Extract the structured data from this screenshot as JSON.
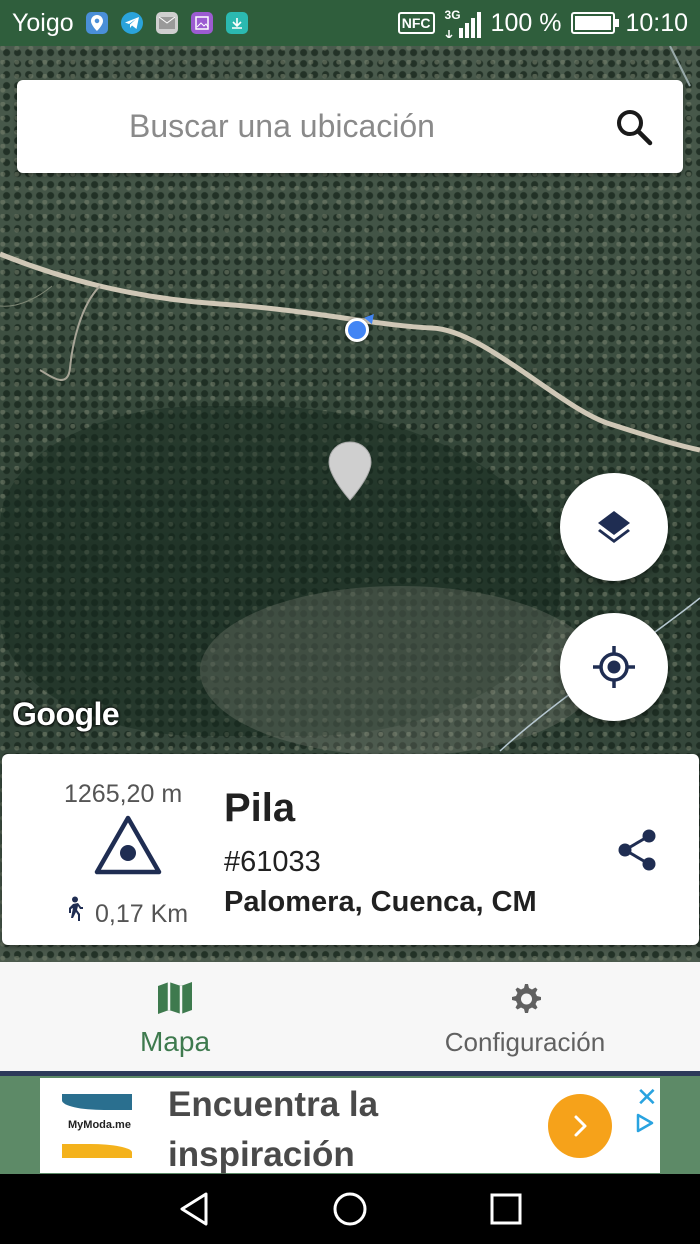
{
  "status_bar": {
    "carrier": "Yoigo",
    "nfc": "NFC",
    "network": "3G",
    "battery": "100 %",
    "battery_level": 1.0,
    "time": "10:10"
  },
  "search": {
    "placeholder": "Buscar una ubicación"
  },
  "map": {
    "attribution": "Google"
  },
  "info_card": {
    "elevation": "1265,20 m",
    "distance": "0,17 Km",
    "name": "Pila",
    "id": "#61033",
    "place": "Palomera, Cuenca, CM"
  },
  "bottom_nav": {
    "items": [
      {
        "label": "Mapa",
        "icon": "map-icon",
        "active": true
      },
      {
        "label": "Configuración",
        "icon": "gear-icon",
        "active": false
      }
    ],
    "active_color": "#3e7a4e"
  },
  "ad": {
    "brand": "MyModa.me",
    "headline": "Encuentra la inspiración",
    "cta_color": "#f6a21a"
  },
  "colors": {
    "status_bar": "#2f5e3c",
    "location_dot": "#4285f4",
    "trig_icon": "#1f2d52"
  }
}
